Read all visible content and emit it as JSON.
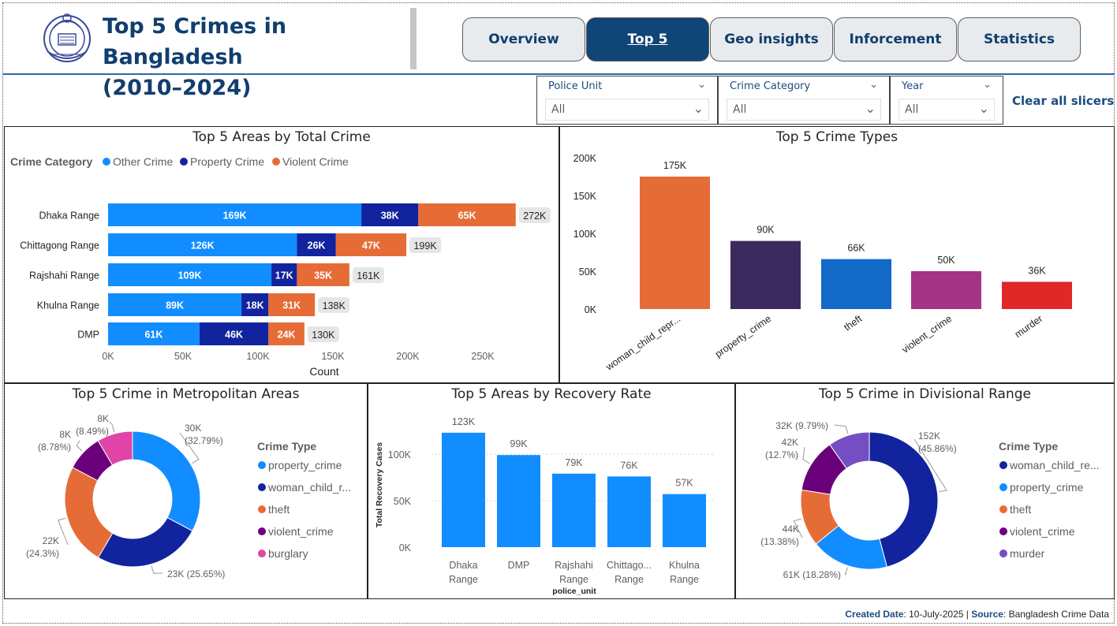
{
  "header": {
    "title_line1": "Top 5 Crimes in Bangladesh",
    "title_line2": "(2010–2024)"
  },
  "nav": {
    "tabs": [
      {
        "label": "Overview",
        "active": false
      },
      {
        "label": "Top 5",
        "active": true
      },
      {
        "label": "Geo insights",
        "active": false
      },
      {
        "label": "Inforcement",
        "active": false
      },
      {
        "label": "Statistics",
        "active": false
      }
    ]
  },
  "slicers": [
    {
      "label": "Police Unit",
      "value": "All"
    },
    {
      "label": "Crime Category",
      "value": "All"
    },
    {
      "label": "Year",
      "value": "All"
    }
  ],
  "clear_label": "Clear all slicers",
  "colors": {
    "accent": "#0f4577",
    "other": "#118dff",
    "property": "#12239e",
    "violent": "#e66c37"
  },
  "chart_data": [
    {
      "type": "bar",
      "orientation": "horizontal",
      "stacked": true,
      "title": "Top 5 Areas by Total Crime",
      "legend_title": "Crime Category",
      "legend_position": "top-left",
      "categories": [
        "Dhaka Range",
        "Chittagong Range",
        "Rajshahi Range",
        "Khulna Range",
        "DMP"
      ],
      "series": [
        {
          "name": "Other Crime",
          "color": "#118dff",
          "values": [
            169,
            126,
            109,
            89,
            61
          ],
          "labels": [
            "169K",
            "126K",
            "109K",
            "89K",
            "61K"
          ]
        },
        {
          "name": "Property Crime",
          "color": "#12239e",
          "values": [
            38,
            26,
            17,
            18,
            46
          ],
          "labels": [
            "38K",
            "26K",
            "17K",
            "18K",
            "46K"
          ]
        },
        {
          "name": "Violent Crime",
          "color": "#e66c37",
          "values": [
            65,
            47,
            35,
            31,
            24
          ],
          "labels": [
            "65K",
            "47K",
            "35K",
            "31K",
            "24K"
          ]
        }
      ],
      "totals": [
        "272K",
        "199K",
        "161K",
        "138K",
        "130K"
      ],
      "xlabel": "Count",
      "xticks": [
        "0K",
        "50K",
        "100K",
        "150K",
        "200K",
        "250K"
      ],
      "xlim": [
        0,
        250
      ]
    },
    {
      "type": "bar",
      "title": "Top 5 Crime Types",
      "categories": [
        "woman_child_repr...",
        "property_crime",
        "theft",
        "violent_crime",
        "murder"
      ],
      "values": [
        175,
        90,
        66,
        50,
        36
      ],
      "labels": [
        "175K",
        "90K",
        "66K",
        "50K",
        "36K"
      ],
      "colors": [
        "#e66c37",
        "#3b2a5e",
        "#1269c7",
        "#a43485",
        "#e12828"
      ],
      "yticks": [
        "0K",
        "50K",
        "100K",
        "150K",
        "200K"
      ],
      "ylim": [
        0,
        200
      ]
    },
    {
      "type": "pie",
      "donut": true,
      "title": "Top 5 Crime in Metropolitan Areas",
      "legend_title": "Crime Type",
      "legend_position": "right",
      "slices": [
        {
          "name": "property_crime",
          "value": 32.79,
          "color": "#118dff",
          "label1": "30K",
          "label2": "(32.79%)"
        },
        {
          "name": "woman_child_r...",
          "value": 25.65,
          "color": "#12239e",
          "label1": "23K (25.65%)",
          "label2": ""
        },
        {
          "name": "theft",
          "value": 24.3,
          "color": "#e66c37",
          "label1": "22K",
          "label2": "(24.3%)"
        },
        {
          "name": "violent_crime",
          "value": 8.78,
          "color": "#6b007b",
          "label1": "8K",
          "label2": "(8.78%)"
        },
        {
          "name": "burglary",
          "value": 8.49,
          "color": "#e044a7",
          "label1": "8K",
          "label2": "(8.49%)"
        }
      ]
    },
    {
      "type": "bar",
      "title": "Top 5 Areas by Recovery Rate",
      "categories": [
        "Dhaka Range",
        "DMP",
        "Rajshahi Range",
        "Chittago... Range",
        "Khulna Range"
      ],
      "values": [
        123,
        99,
        79,
        76,
        57
      ],
      "labels": [
        "123K",
        "99K",
        "79K",
        "76K",
        "57K"
      ],
      "xlabel": "police_unit",
      "ylabel": "Total Recovery Cases",
      "yticks": [
        "0K",
        "50K",
        "100K"
      ],
      "ylim": [
        0,
        130
      ],
      "grid": true
    },
    {
      "type": "pie",
      "donut": true,
      "title": "Top 5 Crime in Divisional Range",
      "legend_title": "Crime Type",
      "legend_position": "right",
      "slices": [
        {
          "name": "woman_child_re...",
          "value": 45.86,
          "color": "#12239e",
          "label1": "152K",
          "label2": "(45.86%)"
        },
        {
          "name": "property_crime",
          "value": 18.28,
          "color": "#118dff",
          "label1": "61K (18.28%)",
          "label2": ""
        },
        {
          "name": "theft",
          "value": 13.38,
          "color": "#e66c37",
          "label1": "44K",
          "label2": "(13.38%)"
        },
        {
          "name": "violent_crime",
          "value": 12.7,
          "color": "#6b007b",
          "label1": "42K",
          "label2": "(12.7%)"
        },
        {
          "name": "murder",
          "value": 9.79,
          "color": "#744ec2",
          "label1": "32K (9.79%)",
          "label2": ""
        }
      ]
    }
  ],
  "footer": {
    "created_label": "Created Date",
    "created_value": ": 10-July-2025 | ",
    "source_label": "Source",
    "source_value": ": Bangladesh Crime Data"
  }
}
